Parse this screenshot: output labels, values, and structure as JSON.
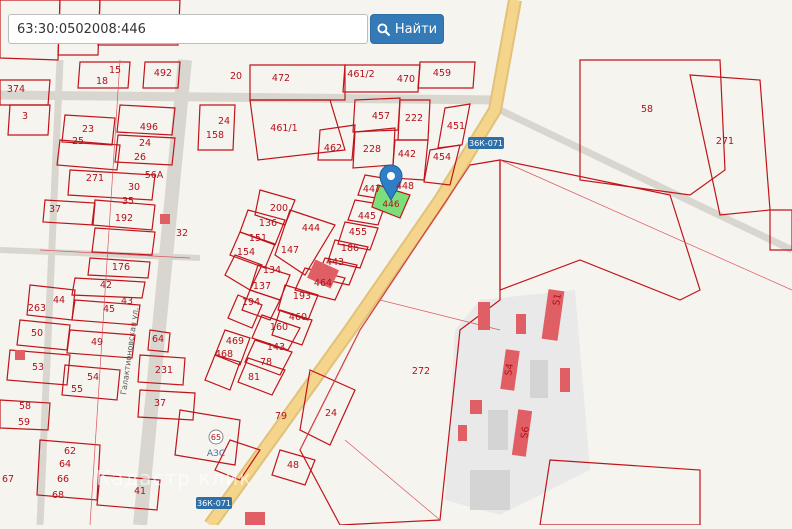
{
  "search": {
    "value": "63:30:0502008:446"
  },
  "find_button": {
    "label": "Найти",
    "icon": "search-icon"
  },
  "road_labels": {
    "highway_top": "36К-071",
    "highway_bottom": "36К-071"
  },
  "street_label": "Галактионовская ул.",
  "gas_station": {
    "number": "65",
    "label": "АЗС"
  },
  "watermark": "Кадастр клик",
  "selected_parcel": "446",
  "parcel_labels": [
    "15",
    "18",
    "492",
    "20",
    "472",
    "461/2",
    "470",
    "459",
    "374",
    "3",
    "23",
    "496",
    "25",
    "24",
    "26",
    "271",
    "30",
    "56А",
    "35",
    "37",
    "192",
    "32",
    "176",
    "42",
    "43",
    "44",
    "263",
    "45",
    "50",
    "49",
    "53",
    "54",
    "55",
    "58",
    "59",
    "62",
    "64",
    "66",
    "67",
    "68",
    "41",
    "24",
    "158",
    "461/1",
    "462",
    "228",
    "457",
    "222",
    "442",
    "451",
    "454",
    "447",
    "448",
    "445",
    "455",
    "186",
    "443",
    "464",
    "444",
    "147",
    "200",
    "136",
    "151",
    "154",
    "134",
    "137",
    "194",
    "193",
    "460",
    "160",
    "143",
    "78",
    "81",
    "469",
    "468",
    "231",
    "37",
    "64",
    "79",
    "24",
    "48",
    "58",
    "271",
    "272",
    "S1",
    "S4",
    "S6"
  ],
  "colors": {
    "parcel_stroke": "#c0141b",
    "parcel_text": "#b3101a",
    "road_fill": "#f2cf84",
    "selected_fill": "#7ce07a",
    "marker": "#2f7fc8",
    "button": "#337ab7",
    "building": "#e05f64",
    "road_shield": "#2f6fa8"
  }
}
